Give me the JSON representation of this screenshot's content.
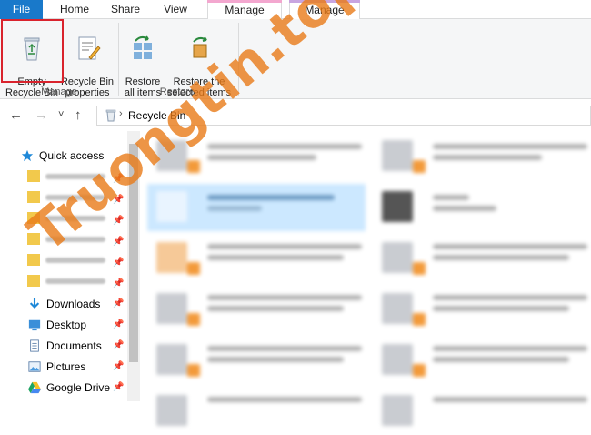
{
  "ribbon_tabs": [
    "File",
    "Home",
    "Share",
    "View",
    "Manage",
    "Manage"
  ],
  "ribbon": {
    "manage_group": "Manage",
    "restore_group": "Restore",
    "empty_recycle_bin": "Empty\nRecycle Bin",
    "recycle_bin_properties": "Recycle Bin\nproperties",
    "restore_all_items": "Restore\nall items",
    "restore_selected_items": "Restore the\nselected items"
  },
  "address": {
    "back_glyph": "←",
    "forward_glyph": "→",
    "dropdown_glyph": "˅",
    "up_glyph": "↑",
    "path": "Recycle Bin"
  },
  "nav": {
    "quick_access": "Quick access",
    "downloads": "Downloads",
    "desktop": "Desktop",
    "documents": "Documents",
    "pictures": "Pictures",
    "google_drive": "Google Drive",
    "pin_glyph": "📌"
  },
  "colors": {
    "file_tab": "#1979ca",
    "highlight_box": "#d9232d",
    "watermark": "#e87a18",
    "selected_item": "#cce8ff"
  },
  "watermark": "Truongtin.top"
}
